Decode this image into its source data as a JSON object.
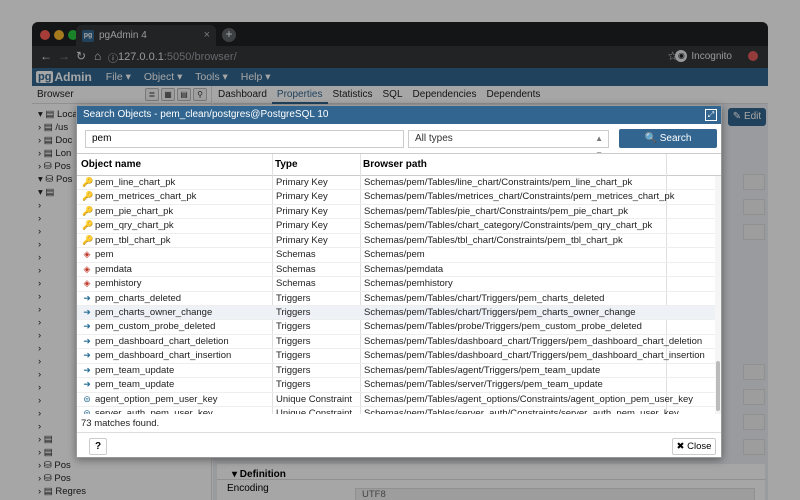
{
  "browser": {
    "tab_title": "pgAdmin 4",
    "favicon_text": "pg",
    "url_host": "127.0.0.1",
    "url_rest": ":5050/browser/",
    "incognito_label": "Incognito"
  },
  "app": {
    "logo_prefix": "pg",
    "logo_suffix": "Admin",
    "menu": [
      "File ▾",
      "Object ▾",
      "Tools ▾",
      "Help ▾"
    ]
  },
  "browser_panel": {
    "title": "Browser",
    "tree": [
      "▾ ▤ Local S",
      "› ▤ /us",
      "› ▤ Doc",
      "› ▤ Lon",
      "› ⛁ Pos",
      "▾ ⛁ Pos",
      "▾ ▤",
      "›",
      "›",
      "›",
      "›",
      "›",
      "›",
      "›",
      "›",
      "›",
      "›",
      "›",
      "›",
      "›",
      "›",
      "›",
      "›",
      "›",
      "›",
      "› ▤",
      "› ▤",
      "› ⛁ Pos",
      "› ⛁ Pos",
      "› ▤ Regres"
    ]
  },
  "main_tabs": [
    "Dashboard",
    "Properties",
    "Statistics",
    "SQL",
    "Dependencies",
    "Dependents"
  ],
  "edit_label": "✎ Edit",
  "definition": {
    "heading": "▾ Definition",
    "encoding_label": "Encoding",
    "encoding_value": "UTF8"
  },
  "dialog": {
    "title": "Search Objects - pem_clean/postgres@PostgreSQL 10",
    "search_value": "pem",
    "type_filter": "All types",
    "search_button": "🔍 Search",
    "columns": [
      "Object name",
      "Type",
      "Browser path"
    ],
    "rows": [
      {
        "icon": "key",
        "name": "pem_line_chart_pk",
        "type": "Primary Key",
        "path": "Schemas/pem/Tables/line_chart/Constraints/pem_line_chart_pk"
      },
      {
        "icon": "key",
        "name": "pem_metrices_chart_pk",
        "type": "Primary Key",
        "path": "Schemas/pem/Tables/metrices_chart/Constraints/pem_metrices_chart_pk"
      },
      {
        "icon": "key",
        "name": "pem_pie_chart_pk",
        "type": "Primary Key",
        "path": "Schemas/pem/Tables/pie_chart/Constraints/pem_pie_chart_pk"
      },
      {
        "icon": "key",
        "name": "pem_qry_chart_pk",
        "type": "Primary Key",
        "path": "Schemas/pem/Tables/chart_category/Constraints/pem_qry_chart_pk"
      },
      {
        "icon": "key",
        "name": "pem_tbl_chart_pk",
        "type": "Primary Key",
        "path": "Schemas/pem/Tables/tbl_chart/Constraints/pem_tbl_chart_pk"
      },
      {
        "icon": "schema",
        "name": "pem",
        "type": "Schemas",
        "path": "Schemas/pem"
      },
      {
        "icon": "schema",
        "name": "pemdata",
        "type": "Schemas",
        "path": "Schemas/pemdata"
      },
      {
        "icon": "schema",
        "name": "pemhistory",
        "type": "Schemas",
        "path": "Schemas/pemhistory"
      },
      {
        "icon": "trigger",
        "name": "pem_charts_deleted",
        "type": "Triggers",
        "path": "Schemas/pem/Tables/chart/Triggers/pem_charts_deleted"
      },
      {
        "icon": "trigger",
        "name": "pem_charts_owner_change",
        "type": "Triggers",
        "path": "Schemas/pem/Tables/chart/Triggers/pem_charts_owner_change"
      },
      {
        "icon": "trigger",
        "name": "pem_custom_probe_deleted",
        "type": "Triggers",
        "path": "Schemas/pem/Tables/probe/Triggers/pem_custom_probe_deleted"
      },
      {
        "icon": "trigger",
        "name": "pem_dashboard_chart_deletion",
        "type": "Triggers",
        "path": "Schemas/pem/Tables/dashboard_chart/Triggers/pem_dashboard_chart_deletion"
      },
      {
        "icon": "trigger",
        "name": "pem_dashboard_chart_insertion",
        "type": "Triggers",
        "path": "Schemas/pem/Tables/dashboard_chart/Triggers/pem_dashboard_chart_insertion"
      },
      {
        "icon": "trigger",
        "name": "pem_team_update",
        "type": "Triggers",
        "path": "Schemas/pem/Tables/agent/Triggers/pem_team_update"
      },
      {
        "icon": "trigger",
        "name": "pem_team_update",
        "type": "Triggers",
        "path": "Schemas/pem/Tables/server/Triggers/pem_team_update"
      },
      {
        "icon": "unique",
        "name": "agent_option_pem_user_key",
        "type": "Unique Constraint",
        "path": "Schemas/pem/Tables/agent_options/Constraints/agent_option_pem_user_key"
      },
      {
        "icon": "unique",
        "name": "server_auth_pem_user_key",
        "type": "Unique Constraint",
        "path": "Schemas/pem/Tables/server_auth/Constraints/server_auth_pem_user_key"
      }
    ],
    "highlighted_row": 9,
    "matches_text": "73 matches found.",
    "help_label": "?",
    "close_label": "✖ Close"
  }
}
